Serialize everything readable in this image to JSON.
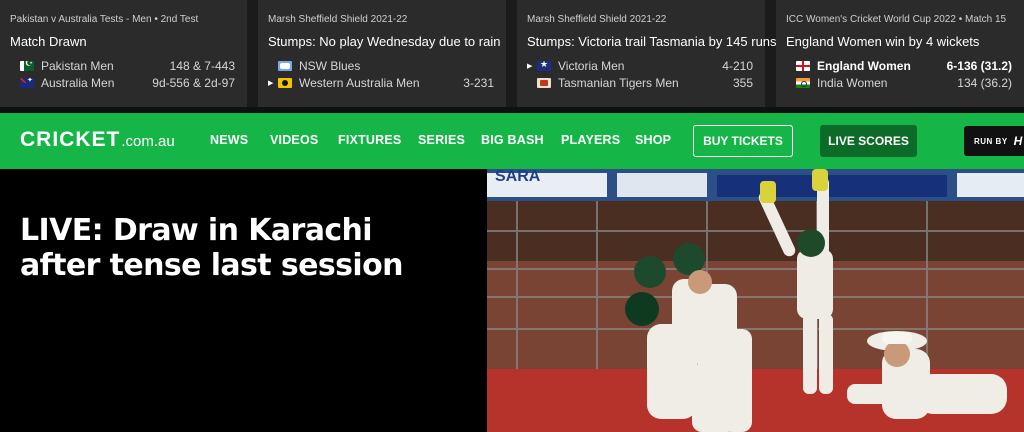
{
  "ticker": [
    {
      "meta": "Pakistan v Australia Tests - Men • 2nd Test",
      "headline": "Match Drawn",
      "teams": [
        {
          "flag": "pakistan-flag",
          "name": "Pakistan Men",
          "score": "148 & 7-443",
          "indicator": "",
          "bold": false
        },
        {
          "flag": "australia-flag",
          "name": "Australia Men",
          "score": "9d-556 & 2d-97",
          "indicator": "",
          "bold": false
        }
      ]
    },
    {
      "meta": "Marsh Sheffield Shield 2021-22",
      "headline": "Stumps: No play Wednesday due to rain",
      "teams": [
        {
          "flag": "nsw-flag",
          "name": "NSW Blues",
          "score": "",
          "indicator": "",
          "bold": false
        },
        {
          "flag": "wa-flag",
          "name": "Western Australia Men",
          "score": "3-231",
          "indicator": "▶",
          "bold": false
        }
      ]
    },
    {
      "meta": "Marsh Sheffield Shield 2021-22",
      "headline": "Stumps: Victoria trail Tasmania by 145 runs ...",
      "teams": [
        {
          "flag": "victoria-flag",
          "name": "Victoria Men",
          "score": "4-210",
          "indicator": "▶",
          "bold": false
        },
        {
          "flag": "tasmania-flag",
          "name": "Tasmanian Tigers Men",
          "score": "355",
          "indicator": "",
          "bold": false
        }
      ]
    },
    {
      "meta": "ICC Women's Cricket World Cup 2022 • Match 15",
      "headline": "England Women win by 4 wickets",
      "teams": [
        {
          "flag": "england-flag",
          "name": "England Women",
          "score": "6-136 (31.2)",
          "indicator": "",
          "bold": true
        },
        {
          "flag": "india-flag",
          "name": "India Women",
          "score": "134 (36.2)",
          "indicator": "",
          "bold": false
        }
      ]
    }
  ],
  "nav": {
    "logo_main": "CRICKET",
    "logo_suffix": ".com.au",
    "links": [
      "NEWS",
      "VIDEOS",
      "FIXTURES",
      "SERIES",
      "BIG BASH",
      "PLAYERS",
      "SHOP"
    ],
    "buy_tickets": "BUY TICKETS",
    "live_scores": "LIVE SCORES",
    "run_by": "RUN BY",
    "sponsor_mark": "H"
  },
  "hero": {
    "title": "LIVE: Draw in Karachi after tense last session",
    "photo_banner_text": "SARA"
  },
  "colors": {
    "nav_green": "#16b548",
    "live_button": "#0d6b2a",
    "ticker_card": "#2b2b2b"
  }
}
